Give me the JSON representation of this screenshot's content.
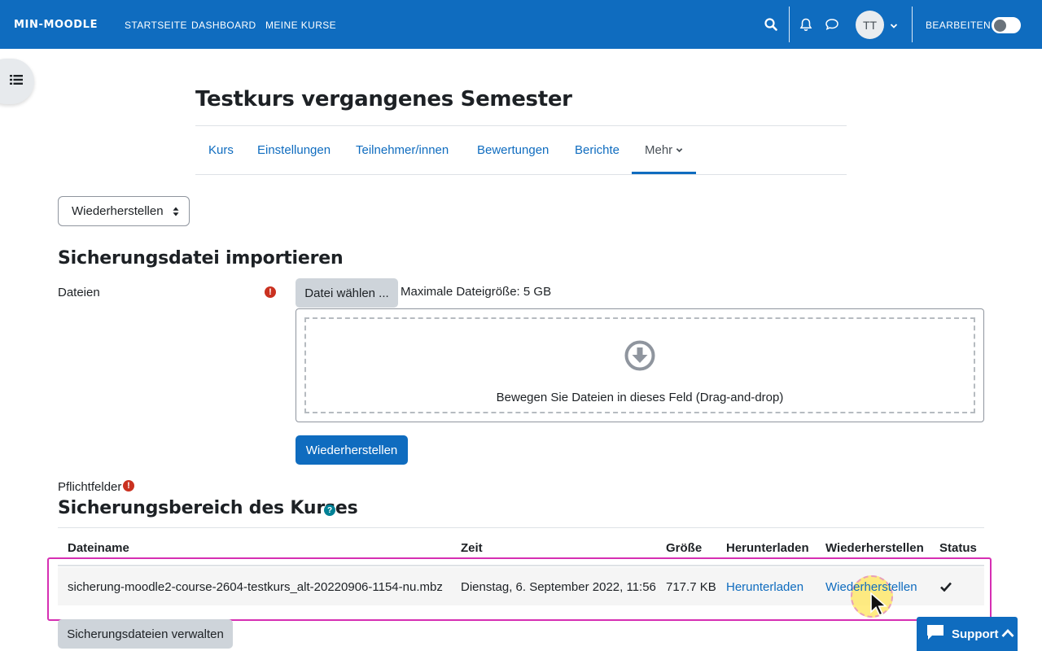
{
  "navbar": {
    "brand": "MIN-MOODLE",
    "links": [
      "STARTSEITE",
      "DASHBOARD",
      "MEINE KURSE"
    ],
    "avatar_initials": "TT",
    "edit_label": "BEARBEITEN",
    "edit_mode_on": false,
    "color": "#0f6cbf"
  },
  "page": {
    "title": "Testkurs vergangenes Semester",
    "tabs": [
      "Kurs",
      "Einstellungen",
      "Teilnehmer/innen",
      "Bewertungen",
      "Berichte",
      "Mehr"
    ],
    "active_tab": "Mehr",
    "select_value": "Wiederherstellen"
  },
  "import": {
    "heading": "Sicherungsdatei importieren",
    "files_label": "Dateien",
    "choose_button": "Datei wählen ...",
    "max_size": "Maximale Dateigröße: 5 GB",
    "drop_text": "Bewegen Sie Dateien in dieses Feld (Drag-and-drop)",
    "restore_button": "Wiederherstellen",
    "required_label": "Pflichtfelder"
  },
  "backup_area": {
    "heading": "Sicherungsbereich des Kurses",
    "columns": [
      "Dateiname",
      "Zeit",
      "Größe",
      "Herunterladen",
      "Wiederherstellen",
      "Status"
    ],
    "rows": [
      {
        "filename": "sicherung-moodle2-course-2604-testkurs_alt-20220906-1154-nu.mbz",
        "time": "Dienstag, 6. September 2022, 11:56",
        "size": "717.7 KB",
        "download": "Herunterladen",
        "restore": "Wiederherstellen",
        "status_icon": "check-icon"
      }
    ],
    "manage_button": "Sicherungsdateien verwalten"
  },
  "support": {
    "label": "Support"
  },
  "icons": {
    "required": "!",
    "help": "?"
  }
}
